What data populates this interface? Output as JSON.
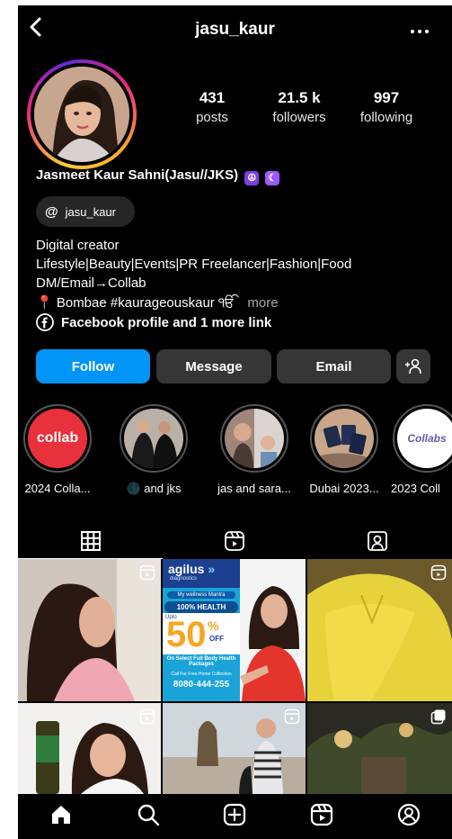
{
  "header": {
    "username": "jasu_kaur",
    "back_icon": "chevron-left-icon",
    "more_icon": "more-horizontal-icon"
  },
  "stats": [
    {
      "value": "431",
      "label": "posts"
    },
    {
      "value": "21.5 k",
      "label": "followers"
    },
    {
      "value": "997",
      "label": "following"
    }
  ],
  "profile": {
    "full_name": "Jasmeet Kaur Sahni(Jasu//JKS)",
    "threads_handle": "jasu_kaur",
    "bio": [
      "Digital creator",
      "Lifestyle|Beauty|Events|PR Freelancer|Fashion|Food",
      "DM/Email→Collab",
      "📍 Bombae #kaurageouskaur ੴ"
    ],
    "more_label": "more",
    "link_text": "Facebook profile and 1 more link"
  },
  "actions": {
    "follow": "Follow",
    "message": "Message",
    "email": "Email",
    "suggest_icon": "person-add-icon"
  },
  "highlights": [
    {
      "caption": "2024 Colla...",
      "inner_text": "collab"
    },
    {
      "caption": "🌑 and jks"
    },
    {
      "caption": "jas and sara..."
    },
    {
      "caption": "Dubai 2023..."
    },
    {
      "caption": "2023 Coll",
      "inner_text": "Collabs"
    }
  ],
  "tabs": [
    "grid-icon",
    "reels-icon",
    "tagged-icon"
  ],
  "posts": [
    {
      "text": ""
    },
    {
      "brand": "agilus",
      "brand_suffix": "»",
      "brand_sub": "diagnostics",
      "mantra": "My wellness Mantra",
      "health": "100% HEALTH",
      "upto": "Upto",
      "discount": "50",
      "pct": "%",
      "off": "OFF",
      "offer": "On Select Full Body Health Packages",
      "call": "Call For Free Home Collection",
      "phone": "8080-444-255"
    },
    {
      "text": ""
    },
    {
      "text": ""
    },
    {
      "text": ""
    },
    {
      "text": ""
    }
  ],
  "colors": {
    "accent_blue": "#0095f6",
    "button_gray": "#363636",
    "collab_red": "#e8313c"
  },
  "nav": [
    "home-icon",
    "search-icon",
    "create-icon",
    "reels-icon",
    "profile-icon"
  ]
}
